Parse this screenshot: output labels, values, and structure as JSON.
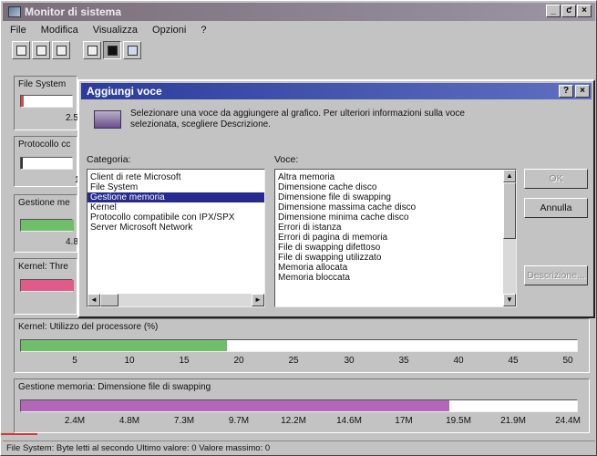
{
  "window": {
    "title": "Monitor di sistema",
    "controls": [
      "_",
      "ƈ",
      "×"
    ]
  },
  "menu": {
    "items": [
      "File",
      "Modifica",
      "Visualizza",
      "Opzioni",
      "?"
    ]
  },
  "toolbar": {
    "buttons": [
      "add-counter-icon",
      "edit-counter-icon",
      "remove-counter-icon",
      "line-chart-icon",
      "bar-chart-icon",
      "numeric-icon"
    ]
  },
  "panels": {
    "fs": {
      "label": "File System"
    },
    "proto": {
      "label": "Protocollo cc"
    },
    "mem": {
      "label": "Gestione me"
    },
    "kern": {
      "label": "Kernel: Thre"
    },
    "cpu": {
      "label": "Kernel: Utilizzo del processore (%)",
      "fill_ratio": 0.37,
      "color": "#6fbf6a",
      "ticks": [
        "5",
        "10",
        "15",
        "20",
        "25",
        "30",
        "35",
        "40",
        "45",
        "50"
      ]
    },
    "swap": {
      "label": "Gestione memoria: Dimensione file di swapping",
      "fill_ratio": 0.77,
      "color": "#b267b8",
      "ticks": [
        "2.4M",
        "4.8M",
        "7.3M",
        "9.7M",
        "12.2M",
        "14.6M",
        "17M",
        "19.5M",
        "21.9M",
        "24.4M"
      ]
    },
    "partial_values": {
      "fs": "2.5",
      "proto": "1",
      "mem": "4.8"
    }
  },
  "status": {
    "text": "File System: Byte letti al secondo    Ultimo valore: 0  Valore massimo: 0"
  },
  "dialog": {
    "title": "Aggiungi voce",
    "controls": [
      "?",
      "×"
    ],
    "message": "Selezionare una voce da aggiungere al grafico. Per ulteriori informazioni sulla voce selezionata, scegliere Descrizione.",
    "category_label": "Categoria:",
    "categories": [
      "Client di rete Microsoft",
      "File System",
      "Gestione memoria",
      "Kernel",
      "Protocollo compatibile con IPX/SPX",
      "Server Microsoft Network"
    ],
    "selected_category": 2,
    "item_label": "Voce:",
    "items": [
      "Altra memoria",
      "Dimensione cache disco",
      "Dimensione file di swapping",
      "Dimensione massima cache disco",
      "Dimensione minima cache disco",
      "Errori di istanza",
      "Errori di pagina di memoria",
      "File di swapping difettoso",
      "File di swapping utilizzato",
      "Memoria allocata",
      "Memoria bloccata"
    ],
    "buttons": {
      "ok": "OK",
      "cancel": "Annulla",
      "describe": "Descrizione..."
    }
  }
}
